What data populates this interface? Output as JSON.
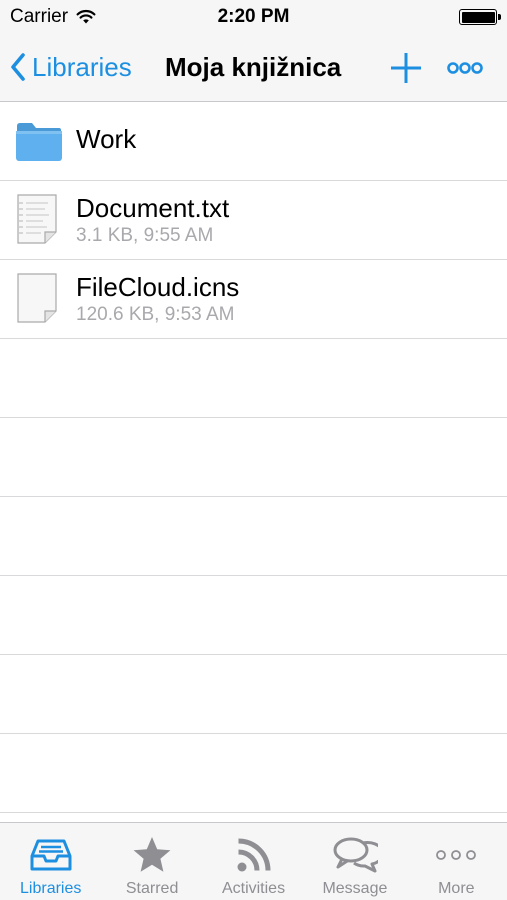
{
  "status_bar": {
    "carrier": "Carrier",
    "time": "2:20 PM",
    "battery_level": 1.0
  },
  "nav": {
    "back_label": "Libraries",
    "title": "Moja knjižnica"
  },
  "files": [
    {
      "name": "Work",
      "type": "folder",
      "icon": "folder-icon"
    },
    {
      "name": "Document.txt",
      "meta": "3.1 KB, 9:55 AM",
      "type": "text",
      "icon": "text-document-icon"
    },
    {
      "name": "FileCloud.icns",
      "meta": "120.6 KB, 9:53 AM",
      "type": "file",
      "icon": "generic-document-icon"
    }
  ],
  "tabs": [
    {
      "label": "Libraries",
      "icon": "inbox-tray-icon",
      "active": true
    },
    {
      "label": "Starred",
      "icon": "star-icon",
      "active": false
    },
    {
      "label": "Activities",
      "icon": "rss-feed-icon",
      "active": false
    },
    {
      "label": "Message",
      "icon": "chat-bubbles-icon",
      "active": false
    },
    {
      "label": "More",
      "icon": "ellipsis-icon",
      "active": false
    }
  ],
  "colors": {
    "accent": "#1d8fe1",
    "inactive": "#8e8e93",
    "bar_background": "#f6f6f7"
  }
}
